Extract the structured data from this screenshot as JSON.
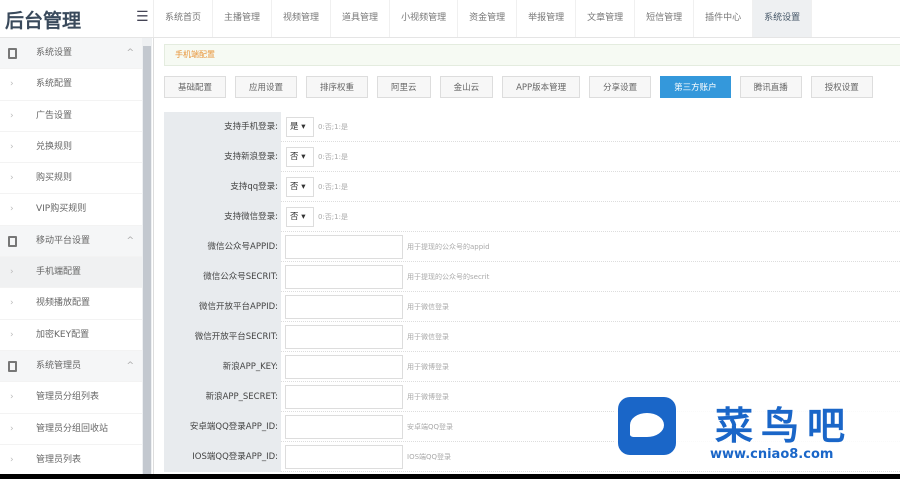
{
  "header": {
    "title": "后台管理",
    "nav": [
      "系统首页",
      "主播管理",
      "视频管理",
      "道具管理",
      "小视频管理",
      "资金管理",
      "举报管理",
      "文章管理",
      "短信管理",
      "插件中心",
      "系统设置"
    ],
    "active_nav": 10
  },
  "sidebar": {
    "items": [
      {
        "label": "系统设置",
        "group": true
      },
      {
        "label": "系统配置"
      },
      {
        "label": "广告设置"
      },
      {
        "label": "兑换规则"
      },
      {
        "label": "购买规则"
      },
      {
        "label": "VIP购买规则"
      },
      {
        "label": "移动平台设置",
        "group": true
      },
      {
        "label": "手机端配置",
        "active": true
      },
      {
        "label": "视频播放配置"
      },
      {
        "label": "加密KEY配置"
      },
      {
        "label": "系统管理员",
        "group": true
      },
      {
        "label": "管理员分组列表"
      },
      {
        "label": "管理员分组回收站"
      },
      {
        "label": "管理员列表"
      }
    ]
  },
  "breadcrumb": "手机端配置",
  "tabs": [
    "基础配置",
    "应用设置",
    "排序权重",
    "阿里云",
    "金山云",
    "APP版本管理",
    "分享设置",
    "第三方账户",
    "腾讯直播",
    "授权设置"
  ],
  "active_tab": 7,
  "form": [
    {
      "label": "支持手机登录:",
      "type": "select",
      "value": "是",
      "hint": "0:否;1:是"
    },
    {
      "label": "支持新浪登录:",
      "type": "select",
      "value": "否",
      "hint": "0:否;1:是"
    },
    {
      "label": "支持qq登录:",
      "type": "select",
      "value": "否",
      "hint": "0:否;1:是"
    },
    {
      "label": "支持微信登录:",
      "type": "select",
      "value": "否",
      "hint": "0:否;1:是"
    },
    {
      "label": "微信公众号APPID:",
      "type": "input",
      "value": "",
      "hint": "用于提现的公众号的appid"
    },
    {
      "label": "微信公众号SECRIT:",
      "type": "input",
      "value": "",
      "hint": "用于提现的公众号的secrit"
    },
    {
      "label": "微信开放平台APPID:",
      "type": "input",
      "value": "",
      "hint": "用于微信登录"
    },
    {
      "label": "微信开放平台SECRIT:",
      "type": "input",
      "value": "",
      "hint": "用于微信登录"
    },
    {
      "label": "新浪APP_KEY:",
      "type": "input",
      "value": "",
      "hint": "用于微博登录"
    },
    {
      "label": "新浪APP_SECRET:",
      "type": "input",
      "value": "",
      "hint": "用于微博登录"
    },
    {
      "label": "安卓端QQ登录APP_ID:",
      "type": "input",
      "value": "",
      "hint": "安卓端QQ登录"
    },
    {
      "label": "IOS端QQ登录APP_ID:",
      "type": "input",
      "value": "",
      "hint": "IOS端QQ登录"
    }
  ],
  "watermark": {
    "name": "菜鸟吧",
    "url": "www.cniao8.com"
  },
  "colors": {
    "accent": "#3498db",
    "breadcrumb": "#e8953a",
    "brand": "#1a66c8"
  }
}
